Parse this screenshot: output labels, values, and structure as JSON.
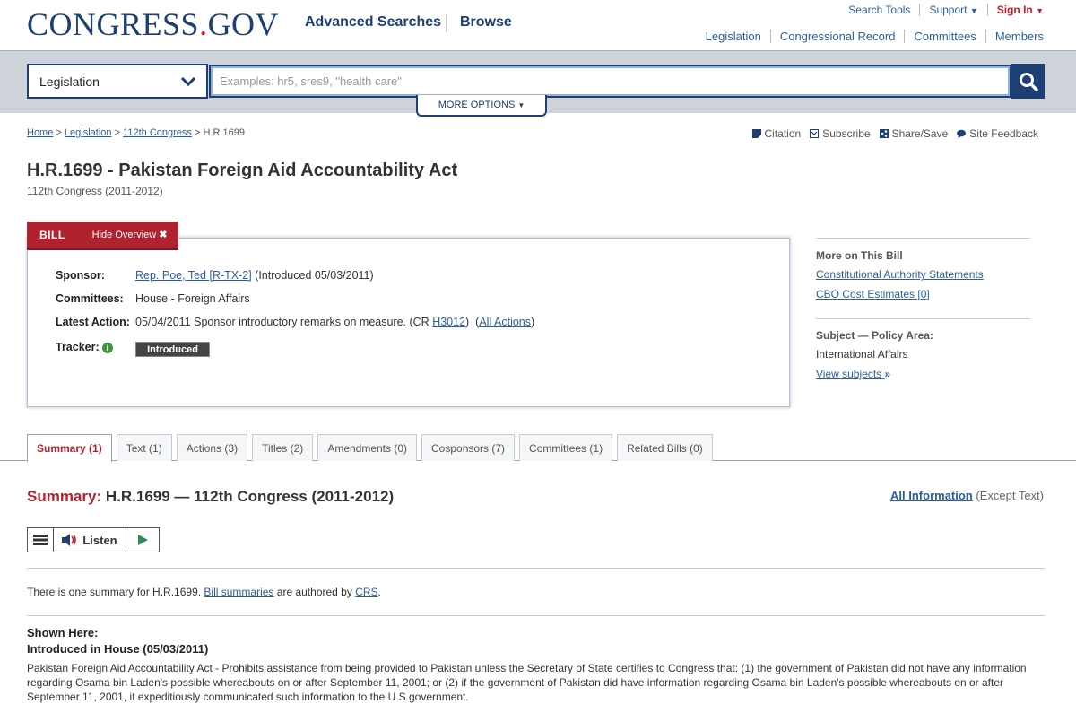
{
  "header": {
    "logo_main": "CONGRESS",
    "logo_dot": ".",
    "logo_tld": "GOV",
    "nav": [
      "Advanced Searches",
      "Browse"
    ],
    "utility": {
      "search_tools": "Search Tools",
      "support": "Support",
      "sign_in": "Sign In"
    },
    "secondary_nav": [
      "Legislation",
      "Congressional Record",
      "Committees",
      "Members"
    ]
  },
  "search": {
    "collection": "Legislation",
    "placeholder": "Examples: hr5, sres9, \"health care\"",
    "more_options": "MORE OPTIONS"
  },
  "breadcrumb": {
    "items": [
      "Home",
      "Legislation",
      "112th Congress"
    ],
    "sep": ">",
    "current": "H.R.1699"
  },
  "page_tools": [
    "Citation",
    "Subscribe",
    "Share/Save",
    "Site Feedback"
  ],
  "bill": {
    "title": "H.R.1699 - Pakistan Foreign Aid Accountability Act",
    "congress": "112th Congress (2011-2012)",
    "tab_label": "BILL",
    "hide_overview": "Hide Overview",
    "labels": {
      "sponsor": "Sponsor:",
      "committees": "Committees:",
      "latest_action": "Latest Action:",
      "tracker": "Tracker:"
    },
    "sponsor_name": "Rep. Poe, Ted [R-TX-2]",
    "sponsor_intro": "(Introduced 05/03/2011)",
    "committees": "House - Foreign Affairs",
    "latest_action_text": "05/04/2011 Sponsor introductory remarks on measure. (CR",
    "latest_action_cr": "H3012",
    "all_actions": "All Actions",
    "tracker_status": "Introduced",
    "info_icon": "i"
  },
  "sidebar": {
    "more_heading": "More on This Bill",
    "links": [
      "Constitutional Authority Statements",
      "CBO Cost Estimates [0]"
    ],
    "subject_heading": "Subject — Policy Area:",
    "policy_area": "International Affairs",
    "view_subjects": "View subjects"
  },
  "tabs": [
    {
      "label": "Summary (1)",
      "active": true
    },
    {
      "label": "Text (1)"
    },
    {
      "label": "Actions (3)"
    },
    {
      "label": "Titles (2)"
    },
    {
      "label": "Amendments (0)"
    },
    {
      "label": "Cosponsors (7)"
    },
    {
      "label": "Committees (1)"
    },
    {
      "label": "Related Bills (0)"
    }
  ],
  "summary": {
    "heading_label": "Summary:",
    "heading_rest": "H.R.1699 — 112th Congress (2011-2012)",
    "all_info_link": "All Information",
    "all_info_suffix": "(Except Text)",
    "listen": "Listen",
    "one_summary_pre": "There is one summary for H.R.1699.",
    "bill_summaries_link": "Bill summaries",
    "authored_by": "are authored by",
    "crs": "CRS",
    "period": ".",
    "shown_here": "Shown Here:",
    "introduced_in": "Introduced in House (05/03/2011)",
    "text": "Pakistan Foreign Aid Accountability Act - Prohibits assistance from being provided to Pakistan unless the Secretary of State certifies to Congress that: (1) the government of Pakistan did not have any information regarding Osama bin Laden's possible whereabouts on or after September 11, 2001; or (2) if the government of Pakistan did have information regarding Osama bin Laden's possible whereabouts on or after September 11, 2001, it expeditiously communicated such information to the U.S government."
  },
  "colors": {
    "brand_blue": "#1d3f73",
    "brand_red": "#b02230",
    "link": "#2a5f9e"
  }
}
